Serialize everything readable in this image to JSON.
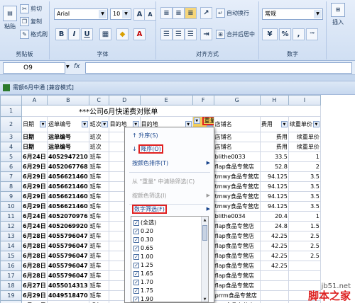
{
  "ribbon": {
    "clipboard": {
      "title": "剪贴板",
      "paste": "粘贴",
      "cut": "剪切",
      "copy": "复制",
      "format_painter": "格式刷"
    },
    "font": {
      "title": "字体",
      "font_name": "Arial",
      "font_size": "10",
      "bold": "B",
      "italic": "I",
      "underline": "U",
      "grow": "A",
      "shrink": "A"
    },
    "alignment": {
      "title": "对齐方式",
      "wrap_text": "自动换行",
      "merge_center": "合并后居中"
    },
    "number": {
      "title": "数字",
      "format": "常规",
      "percent": "%",
      "comma": ","
    },
    "insert": "插入"
  },
  "formula_bar": {
    "name_box": "O9",
    "fx": "fx"
  },
  "window_title": "需额6月中通  [兼容模式]",
  "sheet": {
    "columns": [
      "A",
      "B",
      "C",
      "D",
      "E",
      "F",
      "G",
      "H",
      "I"
    ],
    "title": "***公司6月快递费对账单",
    "header_row": [
      "日期",
      "运单编号",
      "班次",
      "目的地",
      "目的地",
      "重量",
      "店铺名",
      "费用",
      "续重单价"
    ],
    "rows": [
      {
        "num": "3",
        "cells": [
          "日期",
          "运单编号",
          "班次",
          "",
          "",
          "",
          "店铺名",
          "费用",
          "续重单价"
        ]
      },
      {
        "num": "4",
        "cells": [
          "日期",
          "运单编号",
          "班次",
          "",
          "",
          "",
          "店铺名",
          "费用",
          "续重单价"
        ]
      },
      {
        "num": "5",
        "cells": [
          "6月24日",
          "4052947210",
          "班车",
          "",
          "",
          "",
          "blithe0033",
          "33.5",
          "1"
        ]
      },
      {
        "num": "6",
        "cells": [
          "6月29日",
          "4052067768",
          "班车",
          "",
          "",
          "",
          "flap食品专营店",
          "52.8",
          "2"
        ]
      },
      {
        "num": "7",
        "cells": [
          "6月29日",
          "4056621460",
          "班车",
          "",
          "",
          "",
          "tmwy食品专营店",
          "94.125",
          "3.5"
        ]
      },
      {
        "num": "8",
        "cells": [
          "6月29日",
          "4056621460",
          "班车",
          "",
          "",
          "",
          "tmwy食品专营店",
          "94.125",
          "3.5"
        ]
      },
      {
        "num": "9",
        "cells": [
          "6月29日",
          "4056621460",
          "班车",
          "",
          "",
          "",
          "tmwy食品专营店",
          "94.125",
          "3.5"
        ]
      },
      {
        "num": "10",
        "cells": [
          "6月29日",
          "4056621460",
          "班车",
          "",
          "",
          "",
          "tmwy食品专营店",
          "94.125",
          "3.5"
        ]
      },
      {
        "num": "11",
        "cells": [
          "6月24日",
          "4052070976",
          "班车",
          "",
          "",
          "",
          "blithe0034",
          "20.4",
          "1"
        ]
      },
      {
        "num": "12",
        "cells": [
          "6月24日",
          "4052069920",
          "班车",
          "",
          "",
          "",
          "flap食品专营店",
          "24.8",
          "1.5"
        ]
      },
      {
        "num": "13",
        "cells": [
          "6月28日",
          "4055796047",
          "班车",
          "",
          "",
          "",
          "flap食品专营店",
          "42.25",
          "2.5"
        ]
      },
      {
        "num": "14",
        "cells": [
          "6月28日",
          "4055796047",
          "班车",
          "",
          "",
          "",
          "flap食品专营店",
          "42.25",
          "2.5"
        ]
      },
      {
        "num": "15",
        "cells": [
          "6月28日",
          "4055796047",
          "班车",
          "",
          "",
          "",
          "flap食品专营店",
          "42.25",
          "2.5"
        ]
      },
      {
        "num": "16",
        "cells": [
          "6月28日",
          "4055796047",
          "班车",
          "",
          "",
          "",
          "flap食品专营店",
          "42.25",
          ""
        ]
      },
      {
        "num": "17",
        "cells": [
          "6月28日",
          "4055796047",
          "班车",
          "",
          "",
          "",
          "flap食品专营店",
          "",
          ""
        ]
      },
      {
        "num": "18",
        "cells": [
          "6月27日",
          "4055014313",
          "班车",
          "",
          "",
          "",
          "flap食品专营店",
          "",
          ""
        ]
      },
      {
        "num": "19",
        "cells": [
          "6月29日",
          "4049518470",
          "班车",
          "",
          "",
          "",
          "prrm食品专营店",
          "",
          ""
        ]
      },
      {
        "num": "20",
        "cells": [
          "6月29日",
          "4055014313",
          "班车",
          "",
          "",
          "",
          "flap食品专营店",
          "",
          ""
        ]
      }
    ]
  },
  "filter_menu": {
    "sort_asc": "升序(S)",
    "sort_desc": "降序(O)",
    "sort_by_color": "按颜色排序(T)",
    "clear_filter": "从 \"重量\" 中清除筛选(C)",
    "filter_by_color": "按颜色筛选(I)",
    "number_filter": "数字筛选(F)",
    "items": [
      "(全选)",
      "0.20",
      "0.30",
      "0.65",
      "1.00",
      "1.25",
      "1.65",
      "1.70",
      "1.75",
      "1.90"
    ]
  },
  "watermark": {
    "url": "jb51.net",
    "name": "脚本之家"
  }
}
